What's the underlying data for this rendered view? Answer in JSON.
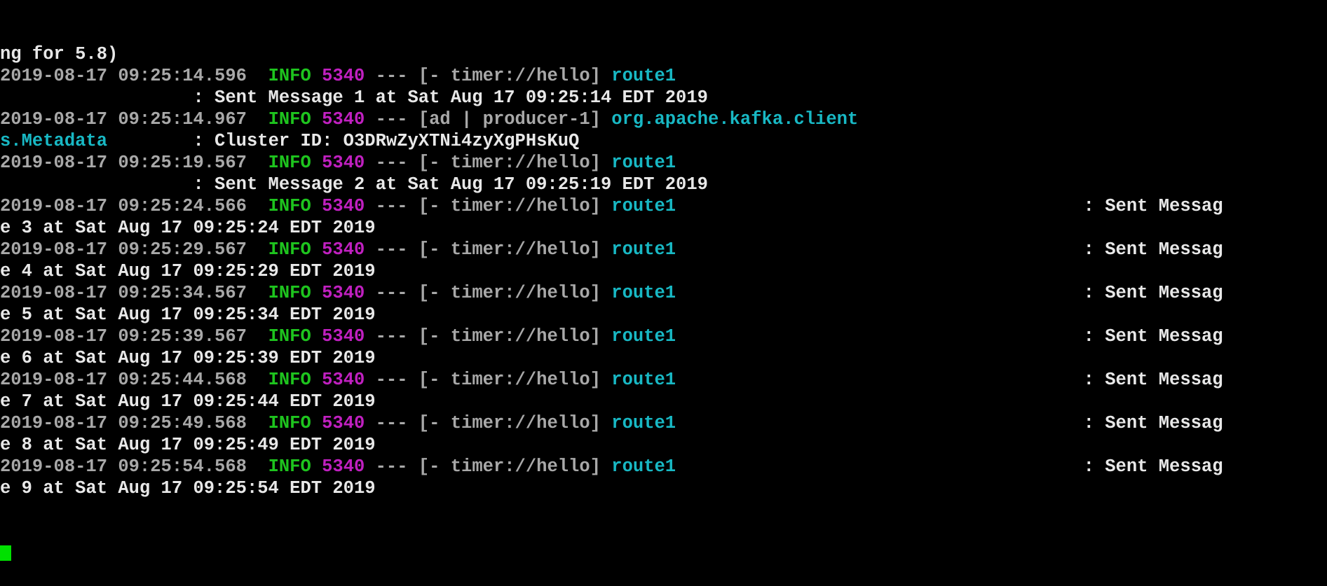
{
  "colors": {
    "background": "#000000",
    "plain": "#e8e8e8",
    "dim": "#a8a8a8",
    "info": "#1ec41e",
    "pid": "#c020c0",
    "logger": "#18b8c4",
    "cursor": "#00e000"
  },
  "lines": [
    [
      {
        "text": "ng for 5.8)",
        "style": "plain"
      }
    ],
    [
      {
        "text": "2019-08-17 09:25:14.596  ",
        "style": "dim"
      },
      {
        "text": "INFO",
        "style": "info"
      },
      {
        "text": " ",
        "style": "dim"
      },
      {
        "text": "5340",
        "style": "pid"
      },
      {
        "text": " --- [- timer://hello] ",
        "style": "dim"
      },
      {
        "text": "route1",
        "style": "logger"
      }
    ],
    [
      {
        "text": "                  : Sent Message 1 at Sat Aug 17 09:25:14 EDT 2019",
        "style": "plain"
      }
    ],
    [
      {
        "text": "2019-08-17 09:25:14.967  ",
        "style": "dim"
      },
      {
        "text": "INFO",
        "style": "info"
      },
      {
        "text": " ",
        "style": "dim"
      },
      {
        "text": "5340",
        "style": "pid"
      },
      {
        "text": " --- [ad | producer-1] ",
        "style": "dim"
      },
      {
        "text": "org.apache.kafka.client",
        "style": "logger"
      }
    ],
    [
      {
        "text": "s.Metadata",
        "style": "logger"
      },
      {
        "text": "        : Cluster ID: O3DRwZyXTNi4zyXgPHsKuQ",
        "style": "plain"
      }
    ],
    [
      {
        "text": "2019-08-17 09:25:19.567  ",
        "style": "dim"
      },
      {
        "text": "INFO",
        "style": "info"
      },
      {
        "text": " ",
        "style": "dim"
      },
      {
        "text": "5340",
        "style": "pid"
      },
      {
        "text": " --- [- timer://hello] ",
        "style": "dim"
      },
      {
        "text": "route1",
        "style": "logger"
      }
    ],
    [
      {
        "text": "                  : Sent Message 2 at Sat Aug 17 09:25:19 EDT 2019",
        "style": "plain"
      }
    ],
    [
      {
        "text": "2019-08-17 09:25:24.566  ",
        "style": "dim"
      },
      {
        "text": "INFO",
        "style": "info"
      },
      {
        "text": " ",
        "style": "dim"
      },
      {
        "text": "5340",
        "style": "pid"
      },
      {
        "text": " --- [- timer://hello] ",
        "style": "dim"
      },
      {
        "text": "route1",
        "style": "logger"
      },
      {
        "text": "                                      : Sent Messag",
        "style": "plain"
      }
    ],
    [
      {
        "text": "e 3 at Sat Aug 17 09:25:24 EDT 2019",
        "style": "plain"
      }
    ],
    [
      {
        "text": "2019-08-17 09:25:29.567  ",
        "style": "dim"
      },
      {
        "text": "INFO",
        "style": "info"
      },
      {
        "text": " ",
        "style": "dim"
      },
      {
        "text": "5340",
        "style": "pid"
      },
      {
        "text": " --- [- timer://hello] ",
        "style": "dim"
      },
      {
        "text": "route1",
        "style": "logger"
      },
      {
        "text": "                                      : Sent Messag",
        "style": "plain"
      }
    ],
    [
      {
        "text": "e 4 at Sat Aug 17 09:25:29 EDT 2019",
        "style": "plain"
      }
    ],
    [
      {
        "text": "2019-08-17 09:25:34.567  ",
        "style": "dim"
      },
      {
        "text": "INFO",
        "style": "info"
      },
      {
        "text": " ",
        "style": "dim"
      },
      {
        "text": "5340",
        "style": "pid"
      },
      {
        "text": " --- [- timer://hello] ",
        "style": "dim"
      },
      {
        "text": "route1",
        "style": "logger"
      },
      {
        "text": "                                      : Sent Messag",
        "style": "plain"
      }
    ],
    [
      {
        "text": "e 5 at Sat Aug 17 09:25:34 EDT 2019",
        "style": "plain"
      }
    ],
    [
      {
        "text": "2019-08-17 09:25:39.567  ",
        "style": "dim"
      },
      {
        "text": "INFO",
        "style": "info"
      },
      {
        "text": " ",
        "style": "dim"
      },
      {
        "text": "5340",
        "style": "pid"
      },
      {
        "text": " --- [- timer://hello] ",
        "style": "dim"
      },
      {
        "text": "route1",
        "style": "logger"
      },
      {
        "text": "                                      : Sent Messag",
        "style": "plain"
      }
    ],
    [
      {
        "text": "e 6 at Sat Aug 17 09:25:39 EDT 2019",
        "style": "plain"
      }
    ],
    [
      {
        "text": "2019-08-17 09:25:44.568  ",
        "style": "dim"
      },
      {
        "text": "INFO",
        "style": "info"
      },
      {
        "text": " ",
        "style": "dim"
      },
      {
        "text": "5340",
        "style": "pid"
      },
      {
        "text": " --- [- timer://hello] ",
        "style": "dim"
      },
      {
        "text": "route1",
        "style": "logger"
      },
      {
        "text": "                                      : Sent Messag",
        "style": "plain"
      }
    ],
    [
      {
        "text": "e 7 at Sat Aug 17 09:25:44 EDT 2019",
        "style": "plain"
      }
    ],
    [
      {
        "text": "2019-08-17 09:25:49.568  ",
        "style": "dim"
      },
      {
        "text": "INFO",
        "style": "info"
      },
      {
        "text": " ",
        "style": "dim"
      },
      {
        "text": "5340",
        "style": "pid"
      },
      {
        "text": " --- [- timer://hello] ",
        "style": "dim"
      },
      {
        "text": "route1",
        "style": "logger"
      },
      {
        "text": "                                      : Sent Messag",
        "style": "plain"
      }
    ],
    [
      {
        "text": "e 8 at Sat Aug 17 09:25:49 EDT 2019",
        "style": "plain"
      }
    ],
    [
      {
        "text": "2019-08-17 09:25:54.568  ",
        "style": "dim"
      },
      {
        "text": "INFO",
        "style": "info"
      },
      {
        "text": " ",
        "style": "dim"
      },
      {
        "text": "5340",
        "style": "pid"
      },
      {
        "text": " --- [- timer://hello] ",
        "style": "dim"
      },
      {
        "text": "route1",
        "style": "logger"
      },
      {
        "text": "                                      : Sent Messag",
        "style": "plain"
      }
    ],
    [
      {
        "text": "e 9 at Sat Aug 17 09:25:54 EDT 2019",
        "style": "plain"
      }
    ]
  ],
  "cursor": {
    "visible": true,
    "shape": "block"
  }
}
